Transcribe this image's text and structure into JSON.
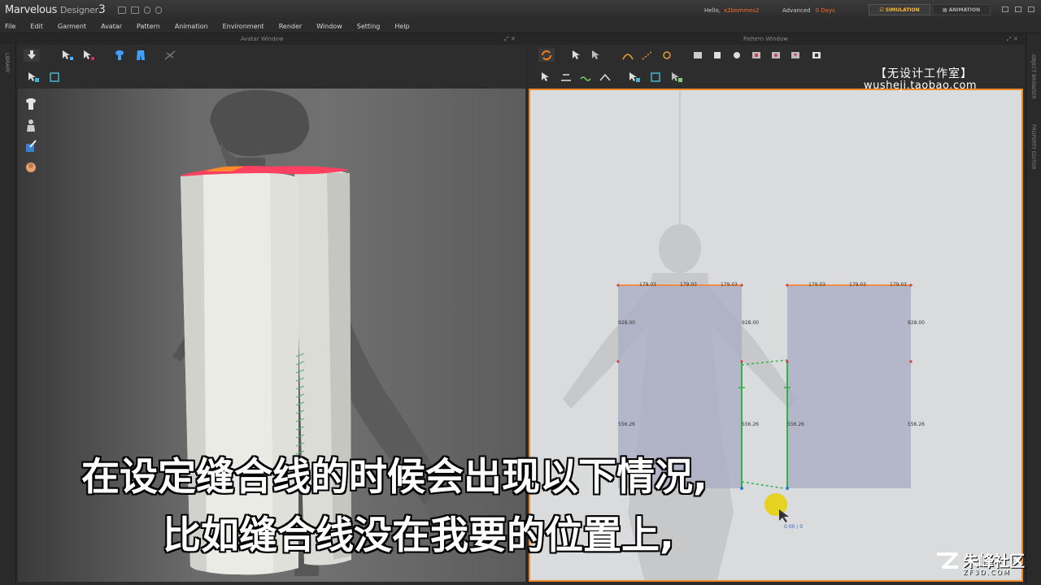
{
  "app": {
    "name_main": "Marvelous",
    "name_sub": "Designer",
    "version": "3"
  },
  "header": {
    "hello_label": "Hello,",
    "username": "x2bommes2",
    "plan_label": "Advanced",
    "days": "0 Days",
    "mode_tabs": [
      "SIMULATION",
      "ANIMATION"
    ],
    "active_mode": "SIMULATION"
  },
  "menu": [
    "File",
    "Edit",
    "Garment",
    "Avatar",
    "Pattern",
    "Animation",
    "Environment",
    "Render",
    "Window",
    "Setting",
    "Help"
  ],
  "windows": {
    "avatar_title": "Avatar Window",
    "pattern_title": "Pattern Window"
  },
  "side_panels": {
    "left": "LIBRARY",
    "right_top": "OBJECT BROWSER",
    "right_bottom": "PROPERTY EDITOR"
  },
  "pattern": {
    "top_labels_left": [
      "179.03",
      "179.03",
      "179.03"
    ],
    "top_labels_right": [
      "179.03",
      "179.03",
      "179.03"
    ],
    "side_labels": {
      "left_top": "928.00",
      "mid_left_top": "928.00",
      "right_top": "928.00",
      "left_bottom": "556.26",
      "mid_left_bottom": "556.26",
      "mid_right_bottom": "556.26",
      "right_bottom": "556.26"
    },
    "cursor_readout": "0.00 / 0"
  },
  "watermark": {
    "line1": "【无设计工作室】",
    "line2": "wusheji.taobao.com"
  },
  "subtitles": {
    "line1": "在设定缝合线的时候会出现以下情况,",
    "line2": "比如缝合线没在我要的位置上,"
  },
  "corner_logo": {
    "name": "朱峰社区",
    "url": "ZF3D.COM"
  },
  "colors": {
    "accent": "#f08a28",
    "user_highlight": "#ff6a2a",
    "sim_tab": "#ffb833",
    "pattern_fill": "#a9acc4",
    "seam_green": "#2fb24a"
  }
}
